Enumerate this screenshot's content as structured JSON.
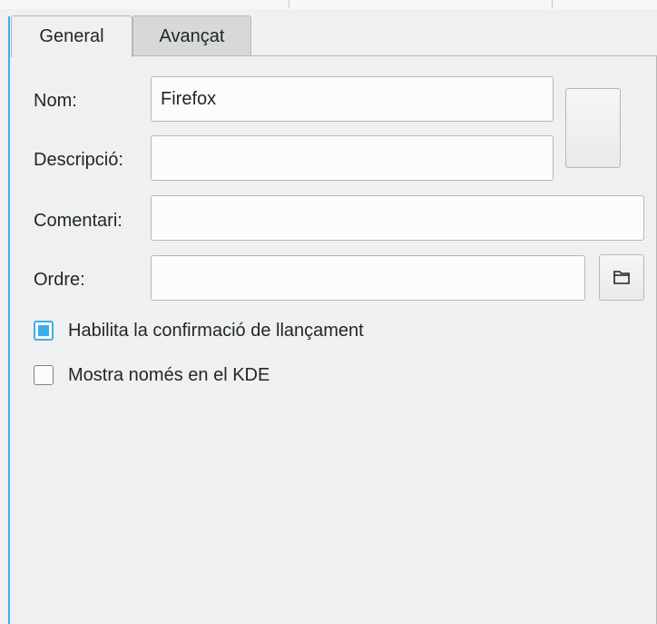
{
  "tabs": [
    {
      "label": "General",
      "active": true
    },
    {
      "label": "Avançat",
      "active": false
    }
  ],
  "form": {
    "name_label": "Nom:",
    "name_value": "Firefox",
    "description_label": "Descripció:",
    "description_value": "",
    "comment_label": "Comentari:",
    "comment_value": "",
    "command_label": "Ordre:",
    "command_value": ""
  },
  "icons": {
    "app_icon_button": "app-icon-placeholder",
    "browse": "folder-icon"
  },
  "options": [
    {
      "label": "Habilita la confirmació de llançament",
      "checked": true
    },
    {
      "label": "Mostra només en el KDE",
      "checked": false
    }
  ],
  "colors": {
    "accent": "#3daee9",
    "background": "#eff0f1"
  }
}
